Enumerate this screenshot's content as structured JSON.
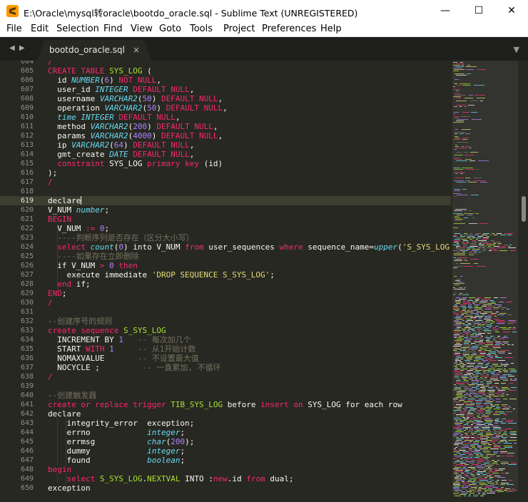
{
  "window": {
    "title": "E:\\Oracle\\mysql转oracle\\bootdo_oracle.sql - Sublime Text (UNREGISTERED)",
    "minimize_glyph": "—",
    "maximize_glyph": "☐",
    "close_glyph": "✕"
  },
  "menu": [
    "File",
    "Edit",
    "Selection",
    "Find",
    "View",
    "Goto",
    "Tools",
    "Project",
    "Preferences",
    "Help"
  ],
  "tabs": {
    "back_glyph": "◀",
    "forward_glyph": "▶",
    "active": {
      "label": "bootdo_oracle.sql",
      "close_glyph": "×"
    },
    "menu_glyph": "▼"
  },
  "editor": {
    "current_line": 619,
    "lines": [
      {
        "n": 604,
        "t": [
          [
            "/",
            "k"
          ]
        ]
      },
      {
        "n": 605,
        "t": [
          [
            "CREATE TABLE ",
            "k"
          ],
          [
            "SYS_LOG",
            "g"
          ],
          [
            " (",
            ""
          ]
        ]
      },
      {
        "n": 606,
        "t": [
          [
            "  id ",
            ""
          ],
          [
            "NUMBER",
            "t"
          ],
          [
            "(",
            ""
          ],
          [
            "6",
            "n"
          ],
          [
            ") ",
            ""
          ],
          [
            "NOT NULL",
            "k"
          ],
          [
            ",",
            ""
          ]
        ]
      },
      {
        "n": 607,
        "t": [
          [
            "  user_id ",
            ""
          ],
          [
            "INTEGER",
            "t"
          ],
          [
            " ",
            ""
          ],
          [
            "DEFAULT NULL",
            "k"
          ],
          [
            ",",
            ""
          ]
        ]
      },
      {
        "n": 608,
        "t": [
          [
            "  username ",
            ""
          ],
          [
            "VARCHAR2",
            "t"
          ],
          [
            "(",
            ""
          ],
          [
            "50",
            "n"
          ],
          [
            ") ",
            ""
          ],
          [
            "DEFAULT NULL",
            "k"
          ],
          [
            ",",
            ""
          ]
        ]
      },
      {
        "n": 609,
        "t": [
          [
            "  operation ",
            ""
          ],
          [
            "VARCHAR2",
            "t"
          ],
          [
            "(",
            ""
          ],
          [
            "50",
            "n"
          ],
          [
            ") ",
            ""
          ],
          [
            "DEFAULT NULL",
            "k"
          ],
          [
            ",",
            ""
          ]
        ]
      },
      {
        "n": 610,
        "t": [
          [
            "  ",
            ""
          ],
          [
            "time",
            "t"
          ],
          [
            " ",
            ""
          ],
          [
            "INTEGER",
            "t"
          ],
          [
            " ",
            ""
          ],
          [
            "DEFAULT NULL",
            "k"
          ],
          [
            ",",
            ""
          ]
        ]
      },
      {
        "n": 611,
        "t": [
          [
            "  method ",
            ""
          ],
          [
            "VARCHAR2",
            "t"
          ],
          [
            "(",
            ""
          ],
          [
            "200",
            "n"
          ],
          [
            ") ",
            ""
          ],
          [
            "DEFAULT NULL",
            "k"
          ],
          [
            ",",
            ""
          ]
        ]
      },
      {
        "n": 612,
        "t": [
          [
            "  params ",
            ""
          ],
          [
            "VARCHAR2",
            "t"
          ],
          [
            "(",
            ""
          ],
          [
            "4000",
            "n"
          ],
          [
            ") ",
            ""
          ],
          [
            "DEFAULT NULL",
            "k"
          ],
          [
            ",",
            ""
          ]
        ]
      },
      {
        "n": 613,
        "t": [
          [
            "  ip ",
            ""
          ],
          [
            "VARCHAR2",
            "t"
          ],
          [
            "(",
            ""
          ],
          [
            "64",
            "n"
          ],
          [
            ") ",
            ""
          ],
          [
            "DEFAULT NULL",
            "k"
          ],
          [
            ",",
            ""
          ]
        ]
      },
      {
        "n": 614,
        "t": [
          [
            "  gmt_create ",
            ""
          ],
          [
            "DATE",
            "t"
          ],
          [
            " ",
            ""
          ],
          [
            "DEFAULT NULL",
            "k"
          ],
          [
            ",",
            ""
          ]
        ]
      },
      {
        "n": 615,
        "t": [
          [
            "  ",
            ""
          ],
          [
            "constraint",
            "k"
          ],
          [
            " SYS_LOG ",
            ""
          ],
          [
            "primary key",
            "k"
          ],
          [
            " (id)",
            ""
          ]
        ]
      },
      {
        "n": 616,
        "t": [
          [
            ");",
            ""
          ]
        ]
      },
      {
        "n": 617,
        "t": [
          [
            "/",
            "k"
          ]
        ]
      },
      {
        "n": 618,
        "t": []
      },
      {
        "n": 619,
        "t": [
          [
            "declare",
            ""
          ]
        ]
      },
      {
        "n": 620,
        "t": [
          [
            "V_NUM ",
            ""
          ],
          [
            "number",
            "t"
          ],
          [
            ";",
            ""
          ]
        ]
      },
      {
        "n": 621,
        "t": [
          [
            "BEGIN",
            "k"
          ]
        ]
      },
      {
        "n": 622,
        "t": [
          [
            "  V_NUM ",
            ""
          ],
          [
            ":=",
            "k"
          ],
          [
            " ",
            ""
          ],
          [
            "0",
            "n"
          ],
          [
            ";",
            ""
          ]
        ]
      },
      {
        "n": 623,
        "t": [
          [
            "  ----判断序列是否存在（区分大小写）",
            "c"
          ]
        ]
      },
      {
        "n": 624,
        "t": [
          [
            "  ",
            ""
          ],
          [
            "select",
            "k"
          ],
          [
            " ",
            ""
          ],
          [
            "count",
            "t"
          ],
          [
            "(",
            ""
          ],
          [
            "0",
            "n"
          ],
          [
            ") into V_NUM ",
            ""
          ],
          [
            "from",
            "k"
          ],
          [
            " user_sequences ",
            ""
          ],
          [
            "where",
            "k"
          ],
          [
            " sequence_name=",
            ""
          ],
          [
            "upper",
            "t"
          ],
          [
            "(",
            ""
          ],
          [
            "'S_SYS_LOG'",
            "s"
          ],
          [
            ");",
            ""
          ]
        ]
      },
      {
        "n": 625,
        "t": [
          [
            "  ----如果存在立即删除",
            "c"
          ]
        ]
      },
      {
        "n": 626,
        "t": [
          [
            "  if V_NUM ",
            ""
          ],
          [
            ">",
            "k"
          ],
          [
            " ",
            ""
          ],
          [
            "0",
            "n"
          ],
          [
            " ",
            ""
          ],
          [
            "then",
            "k"
          ]
        ]
      },
      {
        "n": 627,
        "t": [
          [
            "    execute immediate ",
            ""
          ],
          [
            "'DROP SEQUENCE S_SYS_LOG'",
            "s"
          ],
          [
            ";",
            ""
          ]
        ]
      },
      {
        "n": 628,
        "t": [
          [
            "  ",
            ""
          ],
          [
            "end",
            "k"
          ],
          [
            " if;",
            ""
          ]
        ]
      },
      {
        "n": 629,
        "t": [
          [
            "END",
            "k"
          ],
          [
            ";",
            ""
          ]
        ]
      },
      {
        "n": 630,
        "t": [
          [
            "/",
            "k"
          ]
        ]
      },
      {
        "n": 631,
        "t": []
      },
      {
        "n": 632,
        "t": [
          [
            "--创建序号的规则",
            "c"
          ]
        ]
      },
      {
        "n": 633,
        "t": [
          [
            "create sequence ",
            "k"
          ],
          [
            "S_SYS_LOG",
            "g"
          ]
        ]
      },
      {
        "n": 634,
        "t": [
          [
            "  INCREMENT BY ",
            ""
          ],
          [
            "1",
            "n"
          ],
          [
            "   ",
            ""
          ],
          [
            "-- 每次加几个",
            "c"
          ]
        ]
      },
      {
        "n": 635,
        "t": [
          [
            "  START ",
            ""
          ],
          [
            "WITH",
            "k"
          ],
          [
            " ",
            ""
          ],
          [
            "1",
            "n"
          ],
          [
            "     ",
            ""
          ],
          [
            "-- 从1开始计数",
            "c"
          ]
        ]
      },
      {
        "n": 636,
        "t": [
          [
            "  NOMAXVALUE       ",
            ""
          ],
          [
            "-- 不设置最大值",
            "c"
          ]
        ]
      },
      {
        "n": 637,
        "t": [
          [
            "  NOCYCLE ;         ",
            ""
          ],
          [
            "-- 一直累加, 不循环",
            "c"
          ]
        ]
      },
      {
        "n": 638,
        "t": [
          [
            "/",
            "k"
          ]
        ]
      },
      {
        "n": 639,
        "t": []
      },
      {
        "n": 640,
        "t": [
          [
            "--创建触发器",
            "c"
          ]
        ]
      },
      {
        "n": 641,
        "t": [
          [
            "create",
            "k"
          ],
          [
            " ",
            ""
          ],
          [
            "or",
            "k"
          ],
          [
            " ",
            ""
          ],
          [
            "replace",
            "k"
          ],
          [
            " ",
            ""
          ],
          [
            "trigger",
            "k"
          ],
          [
            " ",
            ""
          ],
          [
            "TIB_SYS_LOG",
            "g"
          ],
          [
            " before ",
            ""
          ],
          [
            "insert",
            "k"
          ],
          [
            " ",
            ""
          ],
          [
            "on",
            "k"
          ],
          [
            " SYS_LOG for each row",
            ""
          ]
        ]
      },
      {
        "n": 642,
        "t": [
          [
            "declare",
            ""
          ]
        ]
      },
      {
        "n": 643,
        "t": [
          [
            "    integrity_error  exception;",
            ""
          ]
        ]
      },
      {
        "n": 644,
        "t": [
          [
            "    errno            ",
            ""
          ],
          [
            "integer",
            "t"
          ],
          [
            ";",
            ""
          ]
        ]
      },
      {
        "n": 645,
        "t": [
          [
            "    errmsg           ",
            ""
          ],
          [
            "char",
            "t"
          ],
          [
            "(",
            ""
          ],
          [
            "200",
            "n"
          ],
          [
            ");",
            ""
          ]
        ]
      },
      {
        "n": 646,
        "t": [
          [
            "    dummy            ",
            ""
          ],
          [
            "integer",
            "t"
          ],
          [
            ";",
            ""
          ]
        ]
      },
      {
        "n": 647,
        "t": [
          [
            "    found            ",
            ""
          ],
          [
            "boolean",
            "t"
          ],
          [
            ";",
            ""
          ]
        ]
      },
      {
        "n": 648,
        "t": [
          [
            "begin",
            "k"
          ]
        ]
      },
      {
        "n": 649,
        "t": [
          [
            "    ",
            ""
          ],
          [
            "select",
            "k"
          ],
          [
            " ",
            ""
          ],
          [
            "S_SYS_LOG",
            "g"
          ],
          [
            ".",
            ""
          ],
          [
            "NEXTVAL",
            "g"
          ],
          [
            " INTO :",
            ""
          ],
          [
            "new",
            "k"
          ],
          [
            ".id ",
            ""
          ],
          [
            "from",
            "k"
          ],
          [
            " dual;",
            ""
          ]
        ]
      },
      {
        "n": 650,
        "t": [
          [
            "exception",
            ""
          ]
        ]
      }
    ]
  },
  "minimap": {
    "palette": [
      "#f92672",
      "#66d9ef",
      "#ae81ff",
      "#e6db74",
      "#a6e22e",
      "#75715e",
      "#f8f8f2"
    ]
  }
}
